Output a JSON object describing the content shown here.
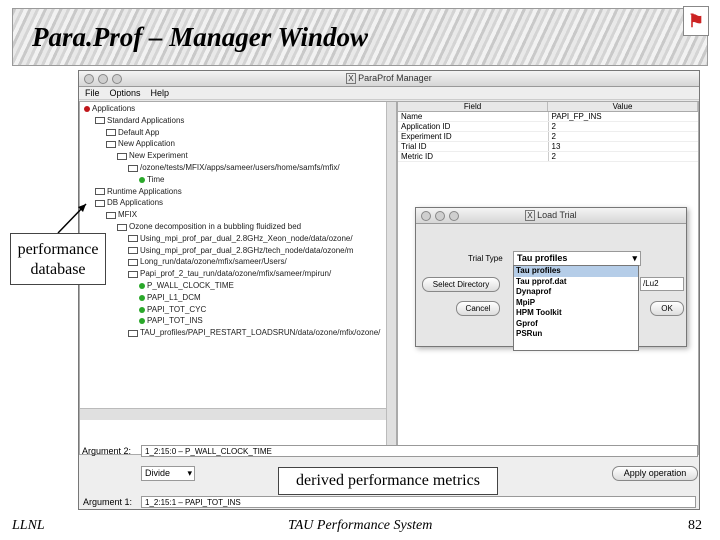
{
  "slide": {
    "title": "Para.Prof  – Manager Window",
    "footer_left": "LLNL",
    "footer_center": "TAU Performance System",
    "page_number": "82"
  },
  "window": {
    "title": "ParaProf Manager",
    "menu": [
      "File",
      "Options",
      "Help"
    ]
  },
  "tree": [
    {
      "label": "Applications",
      "indent": 0,
      "kind": "bulb-red"
    },
    {
      "label": "Standard Applications",
      "indent": 1,
      "kind": "folder"
    },
    {
      "label": "Default App",
      "indent": 2,
      "kind": "folder"
    },
    {
      "label": "New Application",
      "indent": 2,
      "kind": "folder"
    },
    {
      "label": "New Experiment",
      "indent": 3,
      "kind": "folder"
    },
    {
      "label": "/ozone/tests/MFIX/apps/sameer/users/home/samfs/mfix/",
      "indent": 4,
      "kind": "folder"
    },
    {
      "label": "Time",
      "indent": 5,
      "kind": "bulb-green"
    },
    {
      "label": "Runtime Applications",
      "indent": 1,
      "kind": "folder"
    },
    {
      "label": "DB Applications",
      "indent": 1,
      "kind": "folder"
    },
    {
      "label": "MFIX",
      "indent": 2,
      "kind": "folder"
    },
    {
      "label": "Ozone decomposition in a bubbling fluidized bed",
      "indent": 3,
      "kind": "folder"
    },
    {
      "label": "Using_mpi_prof_par_dual_2.8GHz_Xeon_node/data/ozone/",
      "indent": 4,
      "kind": "folder"
    },
    {
      "label": "Using_mpi_prof_par_dual_2.8GHz/tech_node/data/ozone/m",
      "indent": 4,
      "kind": "folder"
    },
    {
      "label": "Long_run/data/ozone/mfix/sameer/Users/",
      "indent": 4,
      "kind": "folder"
    },
    {
      "label": "Papi_prof_2_tau_run/data/ozone/mfix/sameer/mpirun/",
      "indent": 4,
      "kind": "folder"
    },
    {
      "label": "P_WALL_CLOCK_TIME",
      "indent": 5,
      "kind": "bulb-green"
    },
    {
      "label": "PAPI_L1_DCM",
      "indent": 5,
      "kind": "bulb-green"
    },
    {
      "label": "PAPI_TOT_CYC",
      "indent": 5,
      "kind": "bulb-green"
    },
    {
      "label": "PAPI_TOT_INS",
      "indent": 5,
      "kind": "bulb-green"
    },
    {
      "label": "TAU_profiles/PAPI_RESTART_LOADSRUN/data/ozone/mfix/ozone/",
      "indent": 4,
      "kind": "folder"
    }
  ],
  "table": {
    "headers": [
      "Field",
      "Value"
    ],
    "rows": [
      [
        "Name",
        "PAPI_FP_INS"
      ],
      [
        "Application ID",
        "2"
      ],
      [
        "Experiment ID",
        "2"
      ],
      [
        "Trial ID",
        "13"
      ],
      [
        "Metric ID",
        "2"
      ]
    ]
  },
  "bottom": {
    "arg1_label": "Argument 1:",
    "arg1_value": "1_2:15:1 – PAPI_TOT_INS",
    "arg2_label": "Argument 2:",
    "arg2_value": "1_2:15:0 – P_WALL_CLOCK_TIME",
    "op_select": "Divide",
    "apply_button": "Apply operation"
  },
  "dialog": {
    "title": "Load Trial",
    "trial_type_label": "Trial Type",
    "trial_type_value": "Tau profiles",
    "select_dir_button": "Select Directory",
    "cancel_button": "Cancel",
    "ok_button": "OK",
    "path_fragment": "/Lu2",
    "options": [
      "Tau profiles",
      "Tau pprof.dat",
      "Dynaprof",
      "MpiP",
      "HPM Toolkit",
      "Gprof",
      "PSRun"
    ]
  },
  "callouts": {
    "performance_database": "performance database",
    "derived_metrics": "derived performance metrics"
  }
}
